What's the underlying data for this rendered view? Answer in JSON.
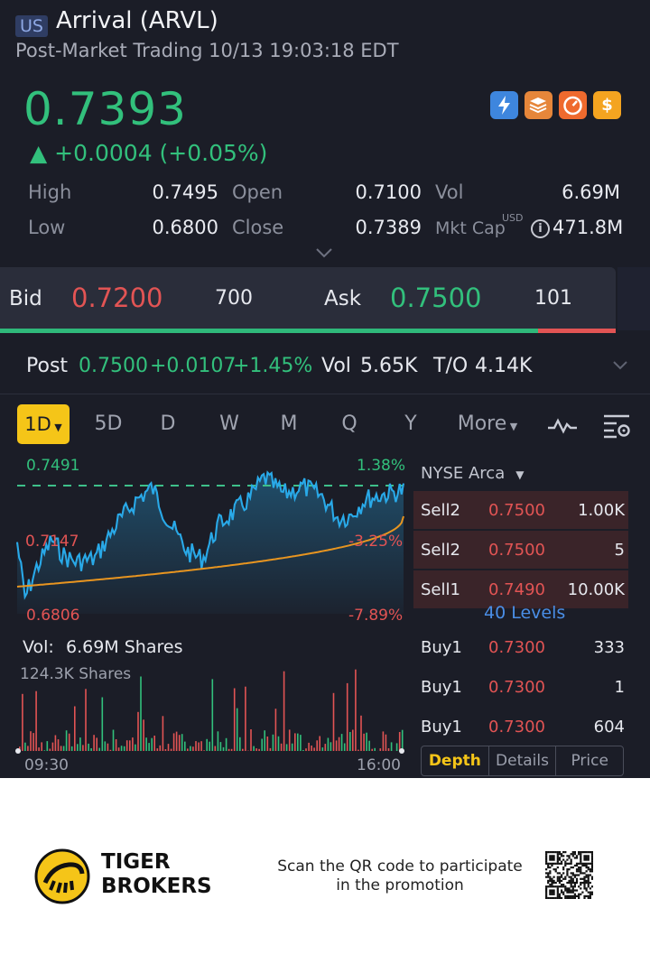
{
  "header": {
    "market": "US",
    "ticker": "Arrival (ARVL)",
    "session": "Post-Market Trading 10/13 19:03:18 EDT",
    "price": "0.7393",
    "change": "▲ +0.0004 (+0.05%)",
    "badges": [
      "lightning-icon",
      "stack-icon",
      "gauge-icon",
      "dollar-icon"
    ],
    "badge_text": {
      "b4": "$"
    }
  },
  "stats": {
    "high_label": "High",
    "high": "0.7495",
    "open_label": "Open",
    "open": "0.7100",
    "vol_label": "Vol",
    "vol": "6.69M",
    "low_label": "Low",
    "low": "0.6800",
    "close_label": "Close",
    "close": "0.7389",
    "mktcap_label": "Mkt Cap",
    "mktcap_unit": "USD",
    "mktcap": "471.8M"
  },
  "bidask": {
    "bid_label": "Bid",
    "bid": "0.7200",
    "bid_size": "700",
    "ask_label": "Ask",
    "ask": "0.7500",
    "ask_size": "101",
    "bid_ratio": 0.874
  },
  "post": {
    "label": "Post",
    "price": "0.7500",
    "change": "+0.0107",
    "pct": "+1.45%",
    "vol_label": "Vol",
    "vol": "5.65K",
    "to_label": "T/O",
    "to": "4.14K"
  },
  "tabs": [
    "1D",
    "5D",
    "D",
    "W",
    "M",
    "Q",
    "Y",
    "More"
  ],
  "chart": {
    "y_top": "0.7491",
    "y_mid": "0.7147",
    "y_bot": "0.6806",
    "pct_top": "1.38%",
    "pct_mid": "-3.25%",
    "pct_bot": "-7.89%",
    "vol_label": "Vol:",
    "vol_value": "6.69M Shares",
    "vol_max": "124.3K Shares",
    "x_start": "09:30",
    "x_end": "16:00"
  },
  "book": {
    "exchange": "NYSE Arca",
    "levels_label": "40 Levels",
    "sells": [
      {
        "side": "Sell2",
        "price": "0.7500",
        "size": "1.00K"
      },
      {
        "side": "Sell2",
        "price": "0.7500",
        "size": "5"
      },
      {
        "side": "Sell1",
        "price": "0.7490",
        "size": "10.00K"
      }
    ],
    "buys": [
      {
        "side": "Buy1",
        "price": "0.7300",
        "size": "333"
      },
      {
        "side": "Buy1",
        "price": "0.7300",
        "size": "1"
      },
      {
        "side": "Buy1",
        "price": "0.7300",
        "size": "604"
      }
    ],
    "tabs": [
      "Depth",
      "Details",
      "Price"
    ]
  },
  "footer": {
    "brand_line1": "TIGER",
    "brand_line2": "BROKERS",
    "promo": "Scan the QR code to participate in the promotion"
  },
  "colors": {
    "up": "#32c07c",
    "down": "#e25454",
    "accent": "#f5c518",
    "price_line": "#29a9e8",
    "avg_line": "#e89520",
    "background": "#1b1d27"
  }
}
